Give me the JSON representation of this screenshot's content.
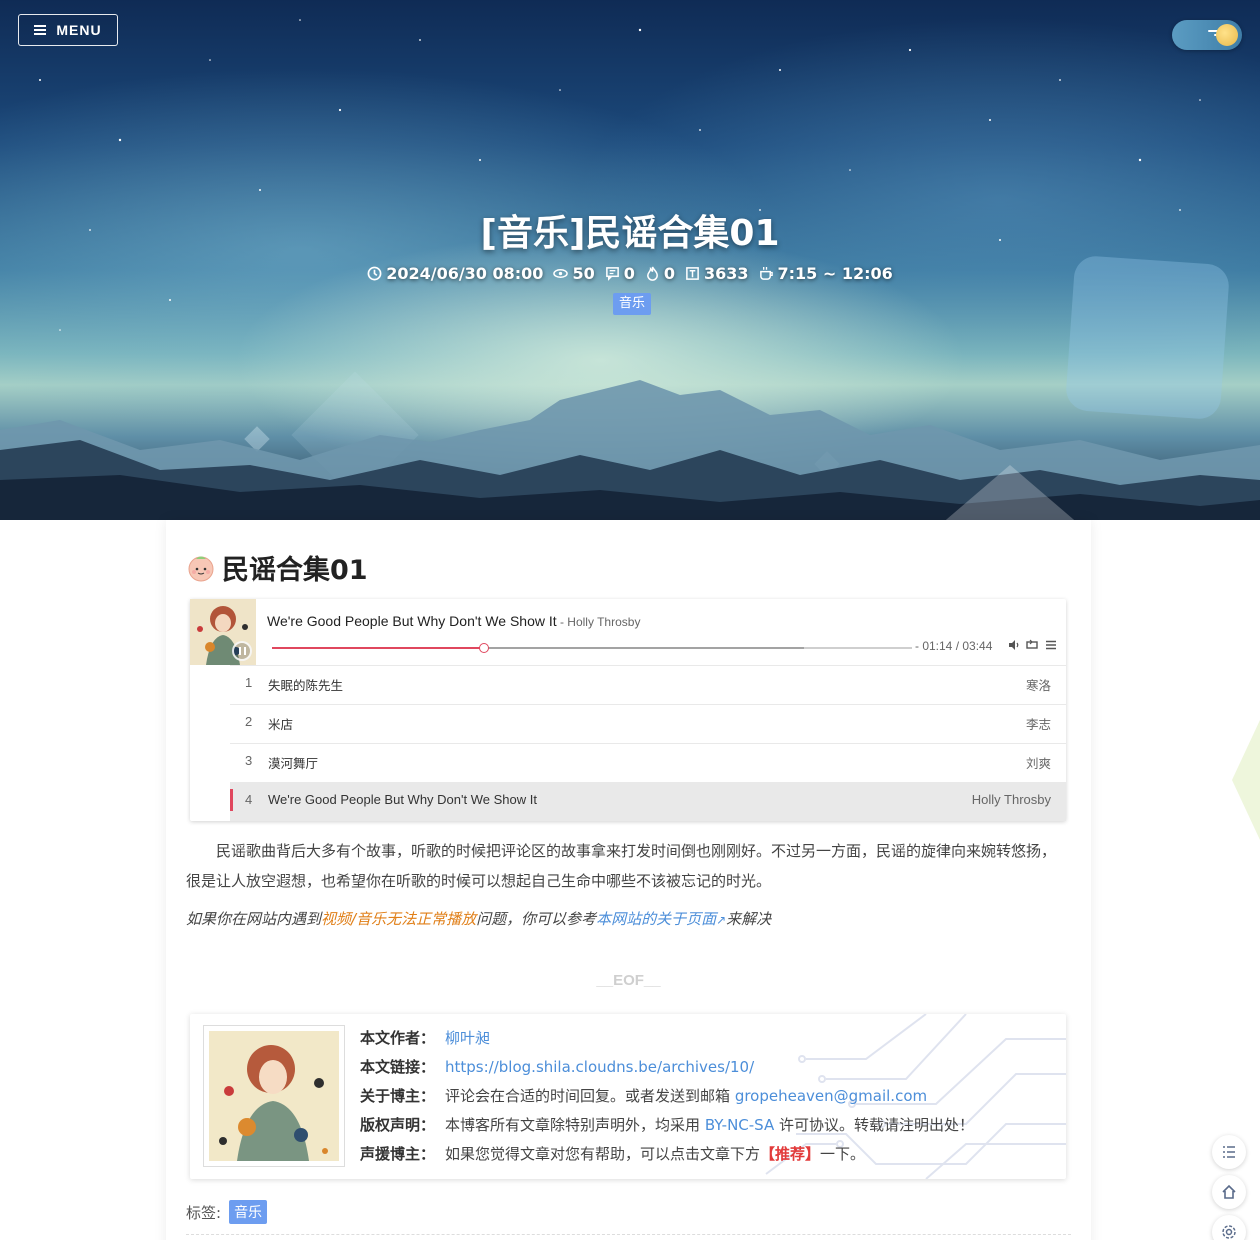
{
  "header": {
    "menu_label": "MENU",
    "title": "[音乐]民谣合集01",
    "meta": {
      "date": "2024/06/30 08:00",
      "views": "50",
      "comments": "0",
      "likes": "0",
      "words": "3633",
      "reading_time": "7:15 ~ 12:06"
    },
    "category": "音乐",
    "icons": {
      "menu": "menu-icon",
      "theme_toggle": "theme-toggle",
      "clock": "clock-icon",
      "eye": "eye-icon",
      "comment": "comment-icon",
      "fire": "fire-icon",
      "word": "text-icon",
      "coffee": "coffee-icon"
    }
  },
  "article": {
    "title": "民谣合集01",
    "title_icon": "peach-emoji-icon",
    "player": {
      "current_title": "We're Good People But Why Don't We Show It",
      "current_artist": " - Holly Throsby",
      "time": "- 01:14 / 03:44",
      "progress_fraction": 0.33,
      "loaded_fraction": 0.83,
      "playlist": [
        {
          "num": "1",
          "name": "失眠的陈先生",
          "artist": "寒洛"
        },
        {
          "num": "2",
          "name": "米店",
          "artist": "李志"
        },
        {
          "num": "3",
          "name": "漠河舞厅",
          "artist": "刘爽"
        },
        {
          "num": "4",
          "name": "We're Good People But Why Don't We Show It",
          "artist": "Holly Throsby"
        }
      ],
      "active_index": 3,
      "accent_color": "#e0475e"
    },
    "paragraph": "民谣歌曲背后大多有个故事，听歌的时候把评论区的故事拿来打发时间倒也刚刚好。不过另一方面，民谣的旋律向来婉转悠扬，很是让人放空遐想，也希望你在听歌的时候可以想起自己生命中哪些不该被忘记的时光。",
    "note": {
      "prefix": "如果你在网站内遇到",
      "orange_text": "视频/音乐无法正常播放",
      "middle": "问题，你可以参考",
      "link_text": "本网站的关于页面",
      "suffix": "来解决"
    },
    "eof": "__EOF__",
    "copyright": {
      "author_label": "本文作者：",
      "author": "柳叶昶",
      "link_label": "本文链接：",
      "link": "https://blog.shila.cloudns.be/archives/10/",
      "about_label": "关于博主：",
      "about_text": "评论会在合适的时间回复。或者发送到邮箱",
      "email": "gropeheaven@gmail.com",
      "license_label": "版权声明：",
      "license_prefix": "本博客所有文章除特别声明外，均采用",
      "license": "BY-NC-SA",
      "license_suffix": "许可协议。转载请注明出处！",
      "support_label": "声援博主：",
      "support_prefix": "如果您觉得文章对您有帮助，可以点击文章下方",
      "support_highlight": "【推荐】",
      "support_suffix": "一下。"
    },
    "tags_label": "标签:",
    "tags": [
      "音乐"
    ]
  },
  "floating": {
    "icons": [
      "toc-icon",
      "home-icon",
      "settings-icon"
    ]
  },
  "colors": {
    "tag_bg": "#6d9df0",
    "link": "#4c8ed9",
    "orange": "#e07f18"
  }
}
